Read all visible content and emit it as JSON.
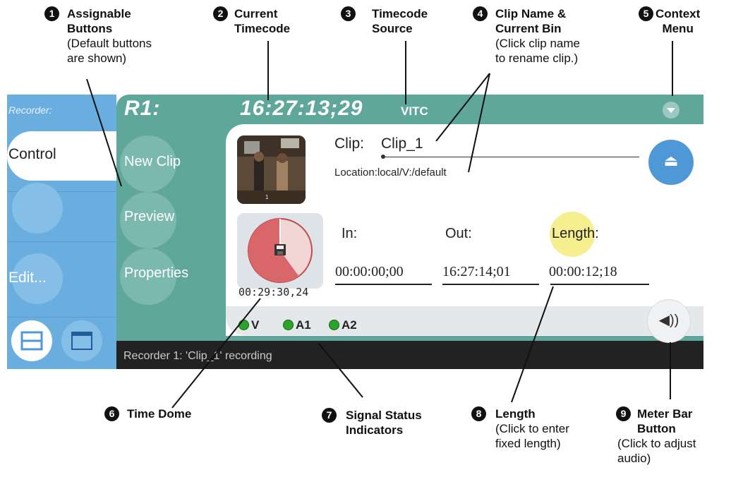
{
  "callouts": [
    {
      "num": "1",
      "title": "Assignable\nButtons",
      "sub": "(Default buttons\nare shown)"
    },
    {
      "num": "2",
      "title": "Current\nTimecode",
      "sub": ""
    },
    {
      "num": "3",
      "title": "Timecode\nSource",
      "sub": ""
    },
    {
      "num": "4",
      "title": "Clip Name &\nCurrent Bin",
      "sub": "(Click clip name\nto rename clip.)"
    },
    {
      "num": "5",
      "title": "Context\nMenu",
      "sub": ""
    },
    {
      "num": "6",
      "title": "Time Dome",
      "sub": ""
    },
    {
      "num": "7",
      "title": "Signal Status\nIndicators",
      "sub": ""
    },
    {
      "num": "8",
      "title": "Length",
      "sub": "(Click to enter\nfixed length)"
    },
    {
      "num": "9",
      "title": "Meter Bar\nButton",
      "sub": "(Click to adjust\naudio)"
    }
  ],
  "sidebar": {
    "section_label": "Recorder:",
    "tabs": [
      "Control",
      "Edit..."
    ]
  },
  "header": {
    "channel": "R1:",
    "timecode": "16:27:13;29",
    "source": "VITC"
  },
  "assignable_buttons": [
    "New Clip",
    "Preview",
    "Properties"
  ],
  "clip": {
    "label": "Clip:",
    "name": "Clip_1",
    "location": "Location:local/V:/default",
    "thumbnail_caption": "1"
  },
  "time_dome": {
    "remaining": "00:29:30,24",
    "fill_fraction": 0.6
  },
  "timecodes": {
    "in_label": "In:",
    "out_label": "Out:",
    "length_label": "Length:",
    "in_value": "00:00:00;00",
    "out_value": "16:27:14;01",
    "length_value": "00:00:12;18"
  },
  "signals": [
    "V",
    "A1",
    "A2"
  ],
  "status": "Recorder 1: 'Clip_1'  recording",
  "icons": {
    "eject": "⏏",
    "meter": "◀))",
    "save": "floppy-icon",
    "context": "chevron-down-icon"
  },
  "colors": {
    "sidebar_blue": "#6aaee0",
    "teal": "#5fa79b",
    "eject_blue": "#4f98d8",
    "dome_red": "#d9676a",
    "led_green": "#2aa52a",
    "highlight_yellow": "#f6ef90"
  }
}
